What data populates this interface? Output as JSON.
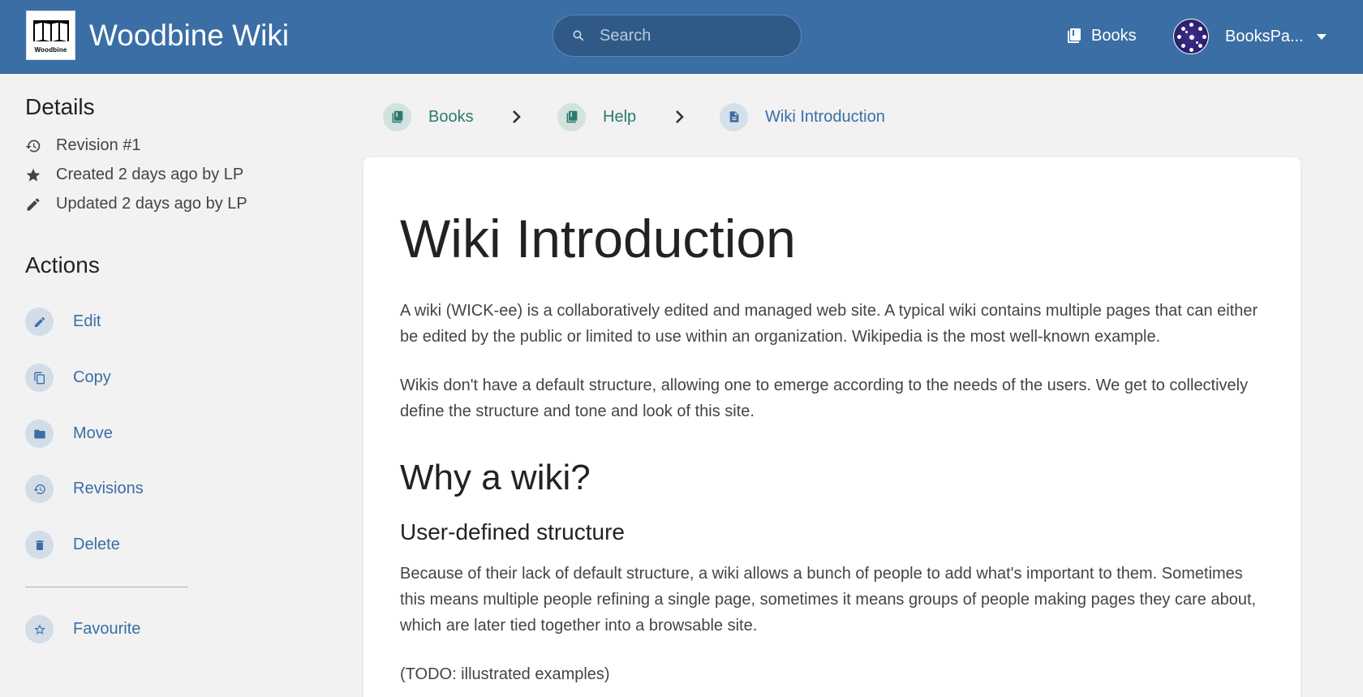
{
  "header": {
    "logo_text": "Woodbine",
    "app_title": "Woodbine Wiki",
    "search_placeholder": "Search",
    "nav_books": "Books",
    "user_name": "BooksPa..."
  },
  "sidebar": {
    "details_title": "Details",
    "details": [
      {
        "icon": "history-icon",
        "text": "Revision #1"
      },
      {
        "icon": "star-icon",
        "text": "Created 2 days ago by LP"
      },
      {
        "icon": "pencil-icon",
        "text": "Updated 2 days ago by LP"
      }
    ],
    "actions_title": "Actions",
    "actions": [
      {
        "icon": "edit-icon",
        "label": "Edit"
      },
      {
        "icon": "copy-icon",
        "label": "Copy"
      },
      {
        "icon": "folder-icon",
        "label": "Move"
      },
      {
        "icon": "history-icon",
        "label": "Revisions"
      },
      {
        "icon": "trash-icon",
        "label": "Delete"
      }
    ],
    "favourite": {
      "icon": "star-outline-icon",
      "label": "Favourite"
    }
  },
  "breadcrumb": [
    {
      "icon": "book-icon",
      "label": "Books"
    },
    {
      "icon": "book-icon",
      "label": "Help"
    },
    {
      "icon": "page-icon",
      "label": "Wiki Introduction"
    }
  ],
  "page": {
    "title": "Wiki Introduction",
    "paragraphs": [
      "A wiki (WICK-ee) is a collaboratively edited and managed web site. A typical wiki contains multiple pages that can either be edited by the public or limited to use within an organization. Wikipedia is the most well-known example.",
      "Wikis don't have a default structure, allowing one to emerge according to the needs of the users. We get to collectively define the structure and tone and look of this site."
    ],
    "h2": "Why a wiki?",
    "h3": "User-defined structure",
    "paragraphs2": [
      "Because of their lack of default structure, a wiki allows a bunch of people to add what's important to them. Sometimes this means multiple people refining a single page, sometimes it means groups of people making pages they care about, which are later tied together into a browsable site.",
      "(TODO: illustrated examples)"
    ]
  },
  "colors": {
    "header": "#3a6ea5",
    "link": "#3a6ea5",
    "book_crumb": "#2c7a6e",
    "page_crumb": "#3a6ea5"
  }
}
